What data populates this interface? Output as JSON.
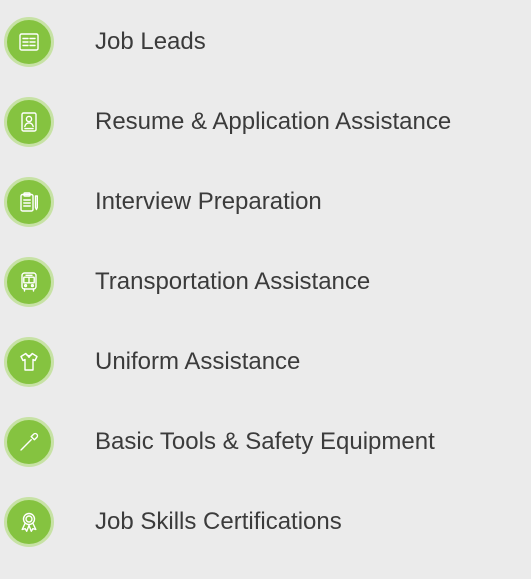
{
  "services": [
    {
      "label": "Job Leads",
      "icon": "document-list-icon"
    },
    {
      "label": "Resume & Application Assistance",
      "icon": "resume-profile-icon"
    },
    {
      "label": "Interview Preparation",
      "icon": "clipboard-pen-icon"
    },
    {
      "label": "Transportation Assistance",
      "icon": "bus-icon"
    },
    {
      "label": "Uniform Assistance",
      "icon": "shirt-icon"
    },
    {
      "label": "Basic Tools & Safety Equipment",
      "icon": "screwdriver-icon"
    },
    {
      "label": "Job Skills Certifications",
      "icon": "award-ribbon-icon"
    }
  ],
  "colors": {
    "background": "#ebebeb",
    "badge_fill": "#85c340",
    "badge_ring": "#c7e2a5",
    "icon_stroke": "#ffffff",
    "text": "#3b3b3b"
  }
}
